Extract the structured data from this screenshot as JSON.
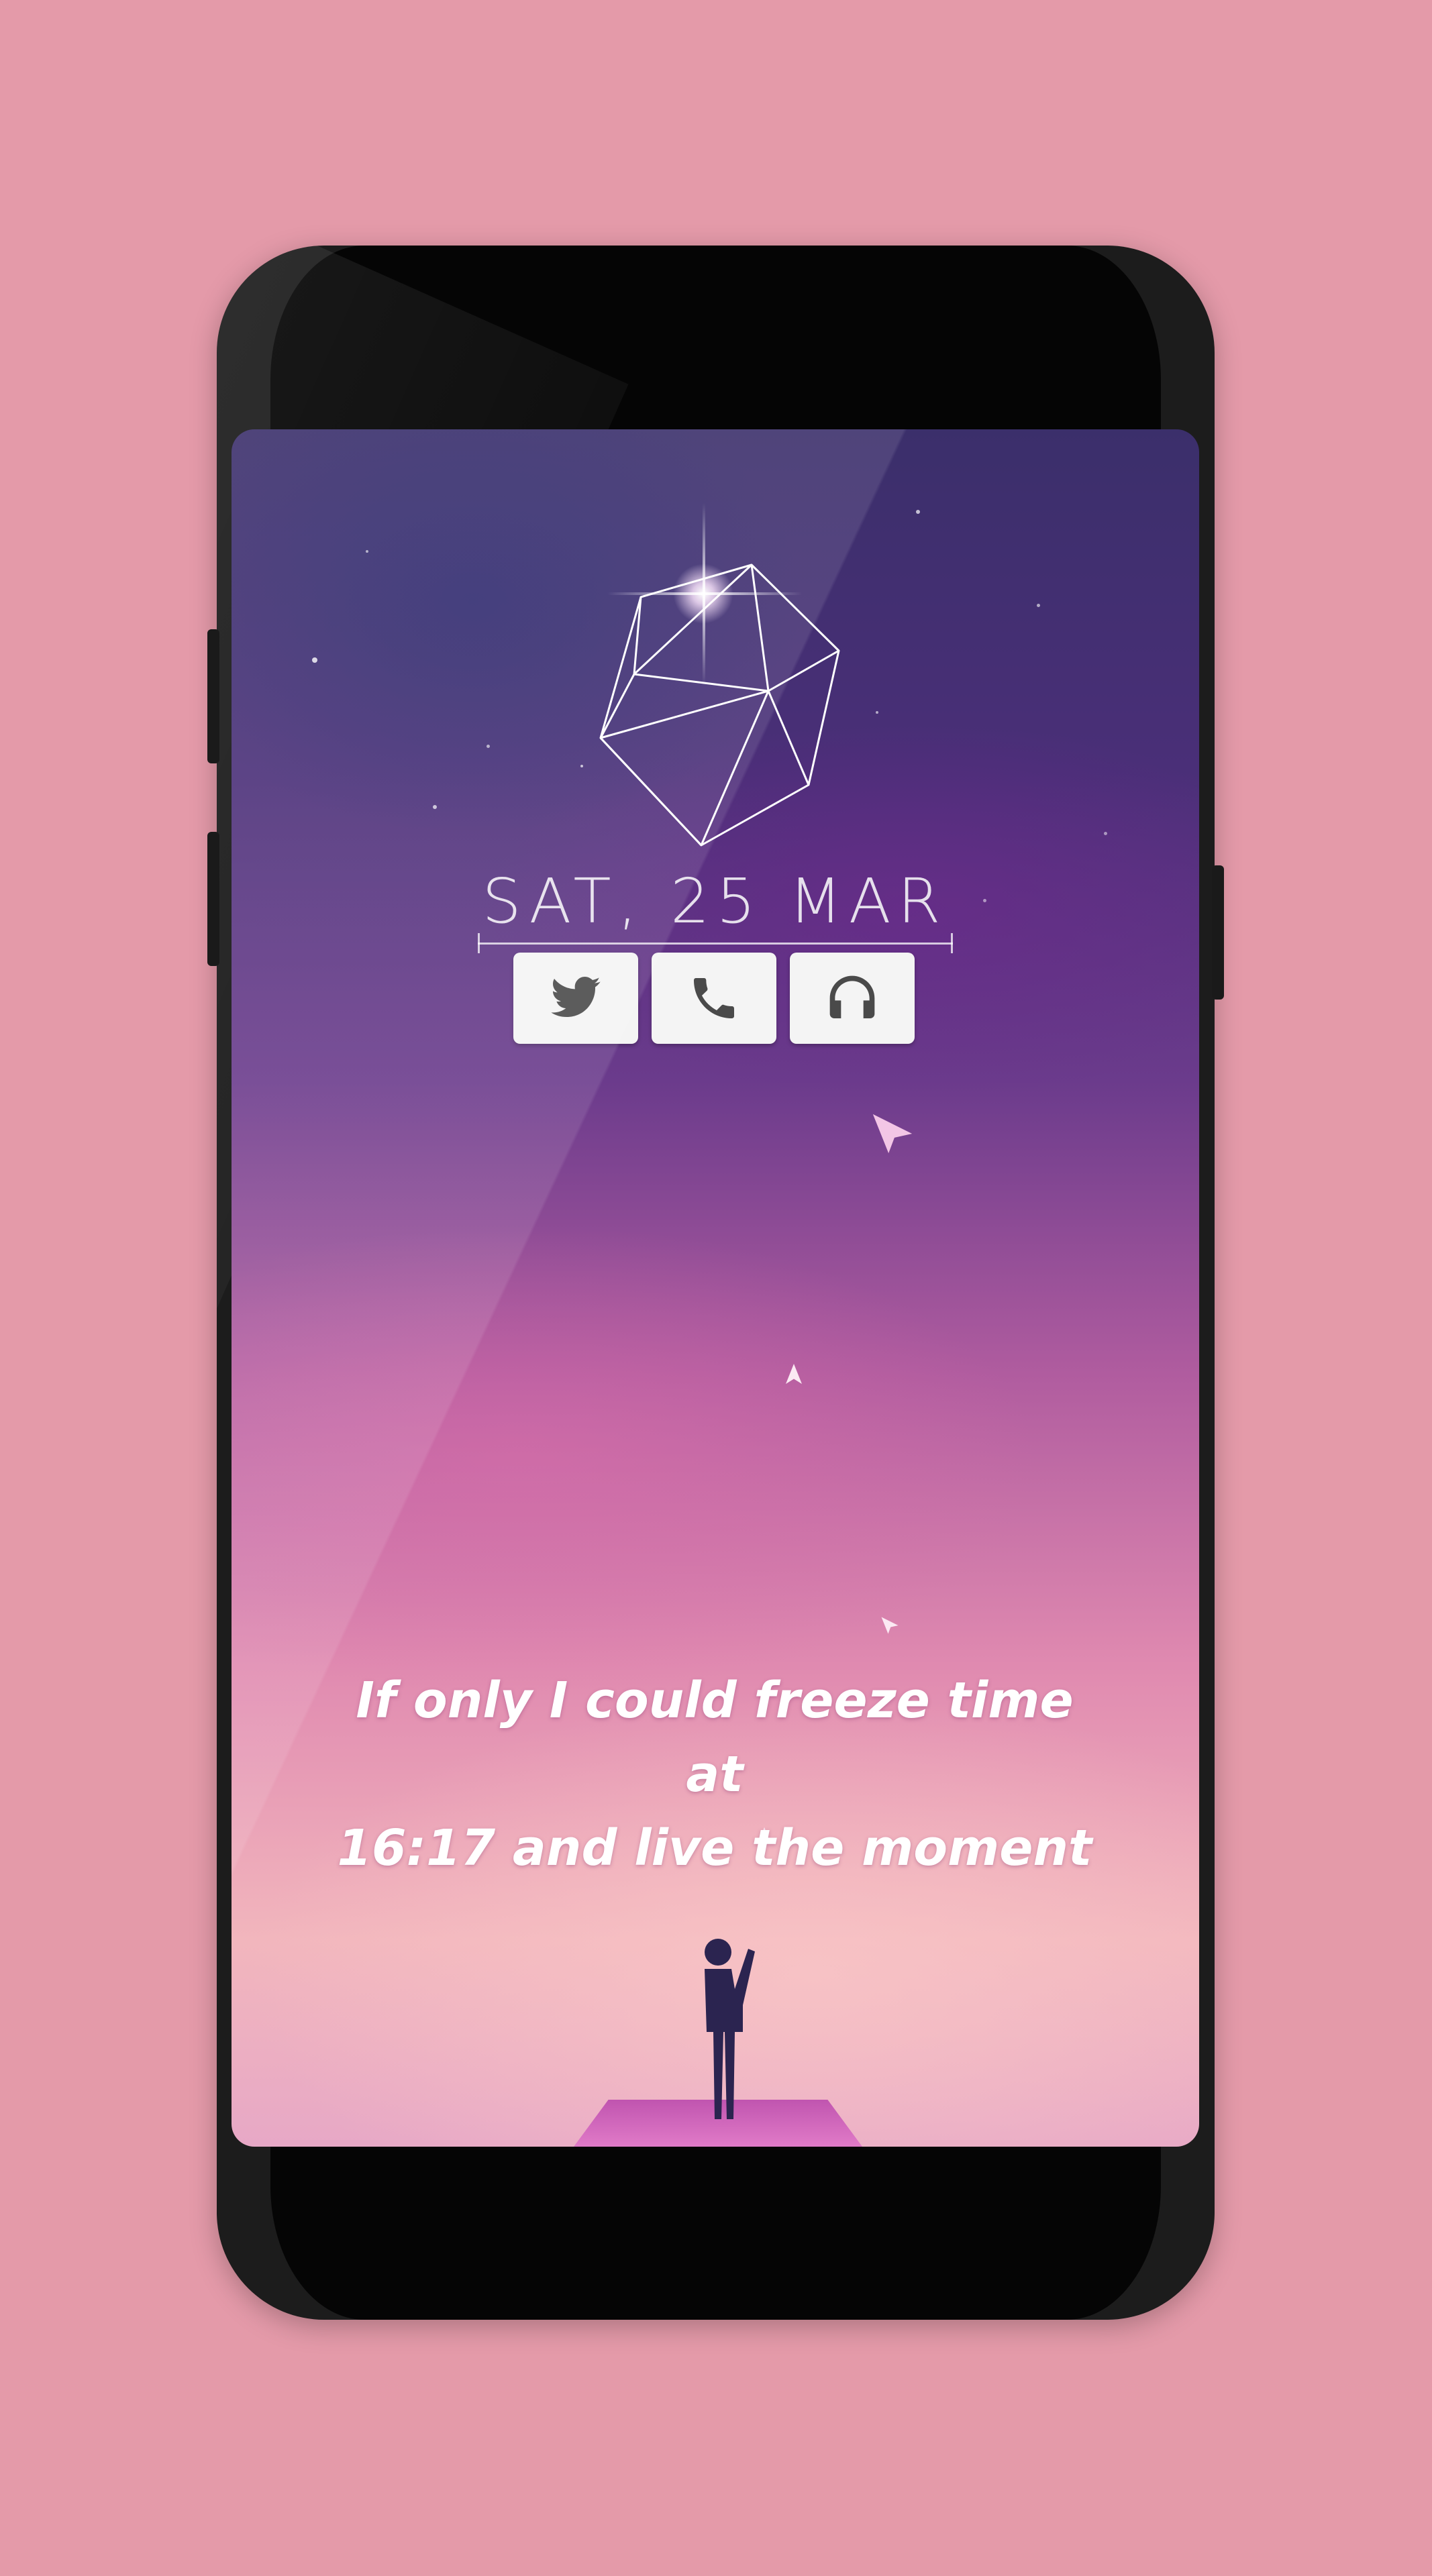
{
  "lockscreen": {
    "date": "SAT, 25 MAR",
    "quote_line1": "If only I could freeze time at",
    "quote_line2": "16:17 and live the moment",
    "shortcuts": [
      {
        "name": "twitter",
        "icon": "twitter-bird-icon"
      },
      {
        "name": "phone",
        "icon": "phone-icon"
      },
      {
        "name": "music",
        "icon": "headphones-icon"
      }
    ]
  },
  "colors": {
    "background": "#e49aa9",
    "phone_body": "#1c1c1c",
    "icon": "#4a4a4a",
    "button": "#f4f4f4"
  }
}
